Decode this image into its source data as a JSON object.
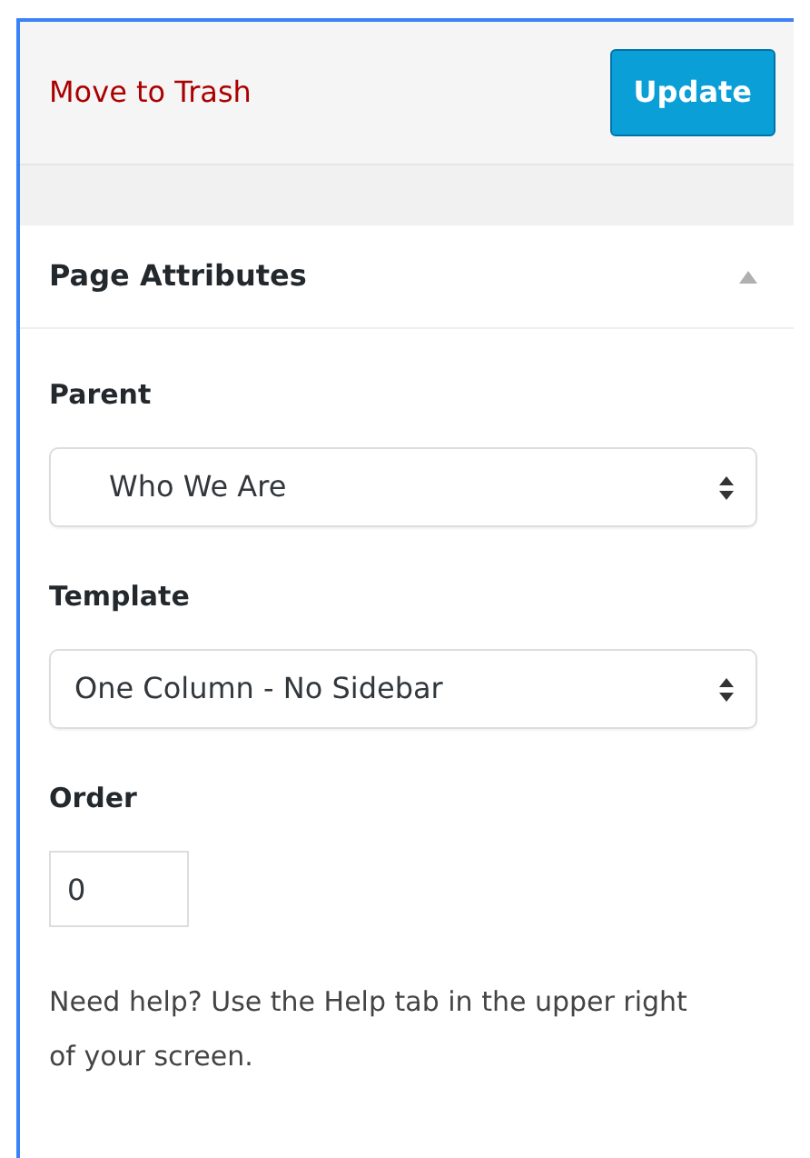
{
  "publish": {
    "trash_link": "Move to Trash",
    "update_button": "Update"
  },
  "page_attributes": {
    "title": "Page Attributes",
    "expanded": true,
    "fields": [
      {
        "kind": "select",
        "label": "Parent",
        "value": "Who We Are",
        "indented": true
      },
      {
        "kind": "select",
        "label": "Template",
        "value": "One Column - No Sidebar",
        "indented": false
      },
      {
        "kind": "number",
        "label": "Order",
        "value": "0"
      }
    ],
    "help": "Need help? Use the Help tab in the upper right of your screen."
  }
}
